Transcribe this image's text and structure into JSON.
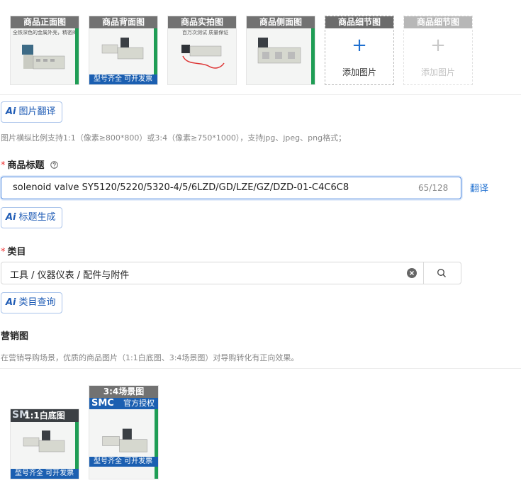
{
  "images": {
    "slots": [
      {
        "caption": "商品正面图",
        "overlay_top": "全铁深色的金属外壳，精密阀芯设计",
        "overlay_bottom": ""
      },
      {
        "caption": "商品背面图",
        "overlay_top": "",
        "overlay_bottom": "型号齐全    可开发票"
      },
      {
        "caption": "商品实拍图",
        "overlay_top": "百万次测试 质量保证",
        "overlay_bottom": ""
      },
      {
        "caption": "商品侧面图",
        "overlay_top": "",
        "overlay_bottom": ""
      }
    ],
    "add_slots": [
      {
        "caption": "商品细节图",
        "plus": "+",
        "label": "添加图片",
        "enabled": true
      },
      {
        "caption": "商品细节图",
        "plus": "+",
        "label": "添加图片",
        "enabled": false
      }
    ],
    "translate_button": {
      "ai": "Ai",
      "label": "图片翻译"
    },
    "hint": "图片横纵比例支持1:1（像素≥800*800）或3:4（像素≥750*1000），支持jpg、jpeg、png格式；"
  },
  "title_field": {
    "required_mark": "*",
    "label": "商品标题",
    "help_icon": "question-circle-icon",
    "value": "solenoid valve SY5120/5220/5320-4/5/6LZD/GD/LZE/GZ/DZD-01-C4C6C8",
    "counter": "65/128",
    "translate_link": "翻译",
    "generate_button": {
      "ai": "Ai",
      "label": "标题生成"
    }
  },
  "category_field": {
    "required_mark": "*",
    "label": "类目",
    "value": "工具 / 仪器仪表 / 配件与附件",
    "clear_icon": "clear-circle-icon",
    "search_icon": "search-icon",
    "query_button": {
      "ai": "Ai",
      "label": "类目查询"
    }
  },
  "marketing": {
    "label": "营销图",
    "hint": "在营销导购场景，优质的商品图片（1:1白底图、3:4场景图）对导购转化有正向效果。",
    "items": [
      {
        "caption": "1:1白底图",
        "brand": "SM",
        "overlay_bottom": "型号齐全    可开发票"
      },
      {
        "caption": "3:4场景图",
        "brand": "SMC",
        "brand_tag": "官方授权",
        "overlay_bottom": "型号齐全    可开发票"
      }
    ]
  },
  "colors": {
    "accent": "#1e5bb5",
    "focus_border": "#4a86e0",
    "required": "#e33333",
    "green": "#1f9d55"
  }
}
